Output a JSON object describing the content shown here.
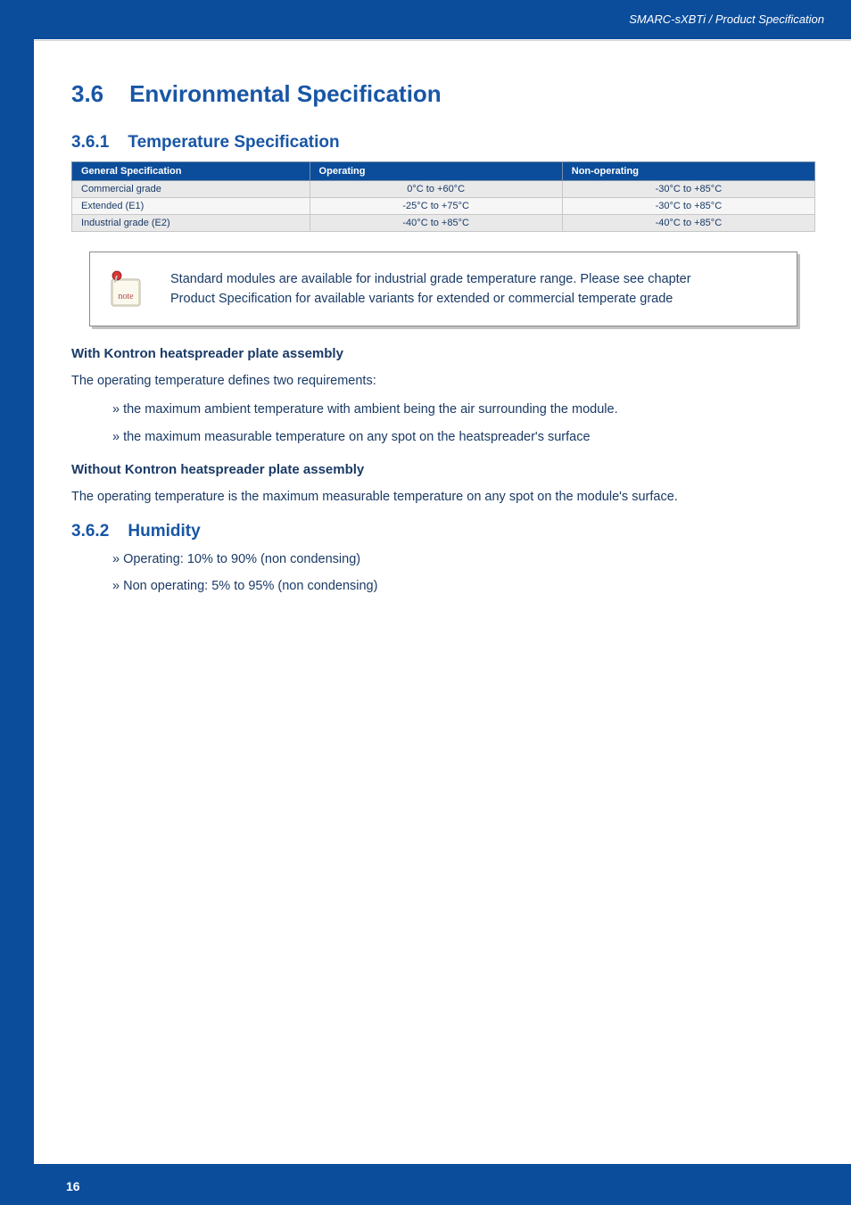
{
  "header": {
    "breadcrumb": "SMARC-sXBTi / Product Specification"
  },
  "section": {
    "num": "3.6",
    "title": "Environmental Specification"
  },
  "subsection1": {
    "num": "3.6.1",
    "title": "Temperature Specification"
  },
  "spec_table": {
    "headers": {
      "col1": "General Specification",
      "col2": "Operating",
      "col3": "Non-operating"
    },
    "rows": [
      {
        "label": "Commercial grade",
        "operating": "0°C to +60°C",
        "nonop": "-30°C to +85°C"
      },
      {
        "label": "Extended (E1)",
        "operating": "-25°C to +75°C",
        "nonop": "-30°C to +85°C"
      },
      {
        "label": "Industrial grade (E2)",
        "operating": "-40°C to +85°C",
        "nonop": "-40°C to +85°C"
      }
    ]
  },
  "note": {
    "line1": "Standard modules are available for industrial grade temperature range. Please see chapter",
    "line2": "Product Specification for available variants for extended or commercial temperate grade",
    "icon_label": "note"
  },
  "with_hs": {
    "heading": "With Kontron heatspreader plate assembly",
    "intro": "The operating temperature defines two requirements:",
    "bullets": [
      "the maximum ambient temperature with ambient being the air surrounding the module.",
      "the maximum measurable temperature on any spot on the heatspreader's surface"
    ]
  },
  "without_hs": {
    "heading": "Without Kontron heatspreader plate assembly",
    "text": "The operating temperature is the maximum measurable temperature on any spot on the module's surface."
  },
  "subsection2": {
    "num": "3.6.2",
    "title": "Humidity",
    "bullets": [
      "Operating: 10% to 90% (non condensing)",
      "Non operating: 5% to 95% (non condensing)"
    ]
  },
  "footer": {
    "page": "16"
  }
}
